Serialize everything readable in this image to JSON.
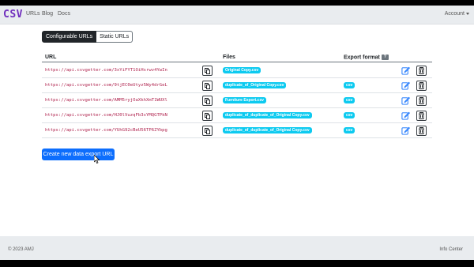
{
  "navbar": {
    "brand": "CSV",
    "links": [
      "URLs",
      "Blog",
      "Docs"
    ],
    "account_label": "Account"
  },
  "tabs": {
    "configurable": "Configurable URLs",
    "static": "Static URLs"
  },
  "table": {
    "headers": {
      "url": "URL",
      "files": "Files",
      "export_format": "Export format",
      "help_badge": "?"
    },
    "rows": [
      {
        "url": "https://api.csvgetter.com/3xYiFYT1OiHsrwv4YwIn",
        "file": "Original Copy.csv",
        "format": ""
      },
      {
        "url": "https://api.csvgetter.com/9tjEC0eUtyz5Wy4drGeL",
        "file": "duplicate_of_Original Copy.csv",
        "format": "csv"
      },
      {
        "url": "https://api.csvgetter.com/AMM5ryjOaXkhXmT1WUXl",
        "file": "Furniture Export.csv",
        "format": "csv"
      },
      {
        "url": "https://api.csvgetter.com/HJ0lVuzqFb3sYMQGTPkN",
        "file": "duplicate_of_duplicate_of_Original Copy.csv",
        "format": "csv"
      },
      {
        "url": "https://api.csvgetter.com/YUhG92cBeU56TP6ZYbpg",
        "file": "duplicate_of_duplicate_of_Original Copy.csv",
        "format": "csv"
      }
    ]
  },
  "create_button": "Create new data export URL",
  "footer": {
    "copyright": "© 2023 AMJ",
    "info": "Info Center"
  },
  "colors": {
    "brand": "#6f2dbd",
    "primary": "#0d6efd",
    "info_badge": "#0dcaf0",
    "url_text": "#b0244f"
  }
}
